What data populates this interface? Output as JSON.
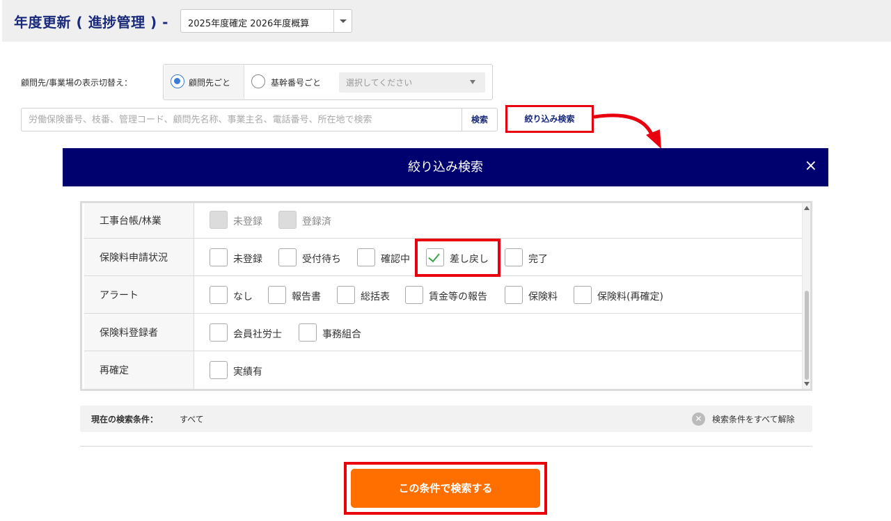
{
  "header": {
    "title": "年度更新 ( 進捗管理 ) -",
    "year_select_value": "2025年度確定 2026年度概算"
  },
  "display_toggle": {
    "label": "顧問先/事業場の表示切替え：",
    "option_client": "顧問先ごと",
    "option_key_number": "基幹番号ごと",
    "selected": "顧問先ごと",
    "key_select_placeholder": "選択してください"
  },
  "search": {
    "placeholder": "労働保険番号、枝番、管理コード、顧問先名称、事業主名、電話番号、所在地で検索",
    "search_button": "検索",
    "filter_button": "絞り込み検索"
  },
  "modal": {
    "title": "絞り込み検索",
    "close": "×",
    "rows": [
      {
        "label": "工事台帳/林業",
        "options": [
          {
            "label": "未登録",
            "checked": false,
            "disabled": true
          },
          {
            "label": "登録済",
            "checked": false,
            "disabled": true
          }
        ]
      },
      {
        "label": "保険料申請状況",
        "options": [
          {
            "label": "未登録",
            "checked": false
          },
          {
            "label": "受付待ち",
            "checked": false
          },
          {
            "label": "確認中",
            "checked": false
          },
          {
            "label": "差し戻し",
            "checked": true
          },
          {
            "label": "完了",
            "checked": false
          }
        ]
      },
      {
        "label": "アラート",
        "options": [
          {
            "label": "なし",
            "checked": false
          },
          {
            "label": "報告書",
            "checked": false
          },
          {
            "label": "総括表",
            "checked": false
          },
          {
            "label": "賃金等の報告",
            "checked": false
          },
          {
            "label": "保険料",
            "checked": false
          },
          {
            "label": "保険料(再確定)",
            "checked": false
          }
        ]
      },
      {
        "label": "保険料登録者",
        "options": [
          {
            "label": "会員社労士",
            "checked": false
          },
          {
            "label": "事務組合",
            "checked": false
          }
        ]
      },
      {
        "label": "再確定",
        "options": [
          {
            "label": "実績有",
            "checked": false
          }
        ]
      }
    ]
  },
  "status": {
    "label": "現在の検索条件：",
    "value": "すべて",
    "clear_label": "検索条件をすべて解除"
  },
  "submit_label": "この条件で検索する",
  "colors": {
    "navy": "#00006e",
    "title_blue": "#1a2a7a",
    "highlight_red": "#e8000f",
    "submit_orange": "#ff6f00",
    "check_green": "#3aa34a"
  }
}
